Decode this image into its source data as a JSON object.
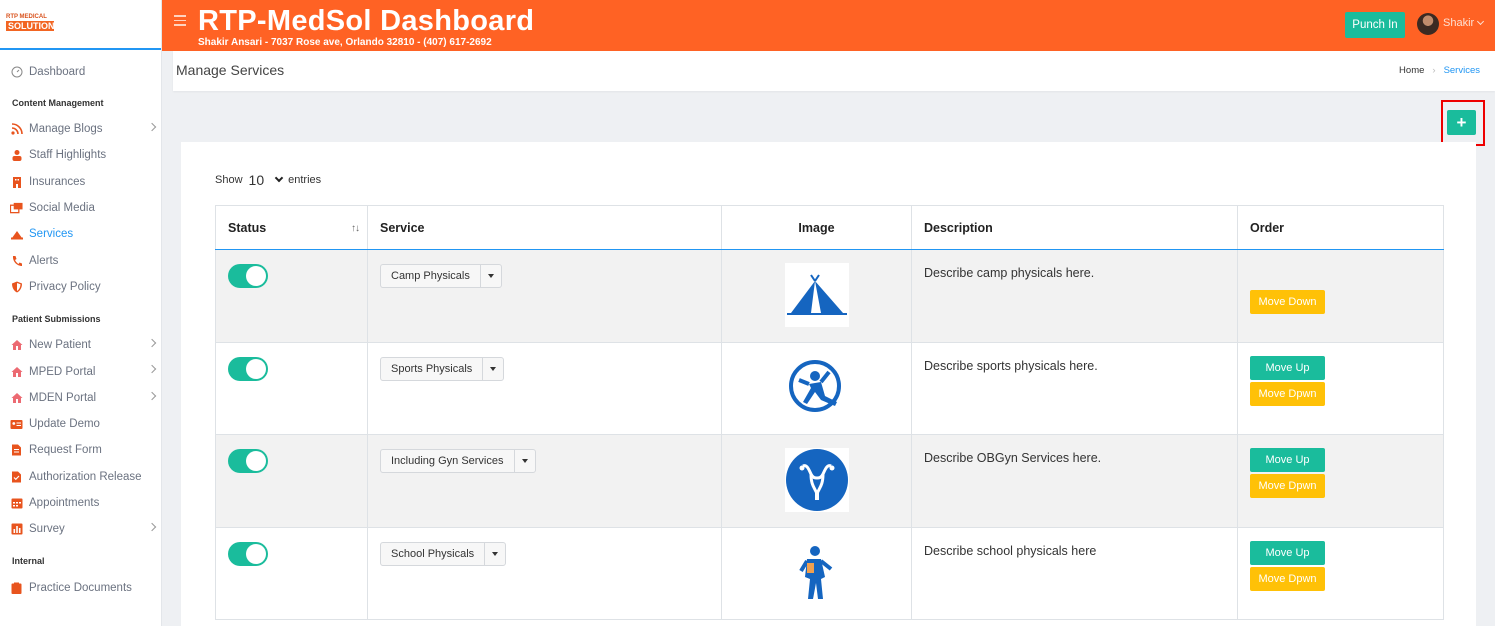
{
  "brand": {
    "logo_top": "RTP MEDICAL",
    "logo_bottom": "SOLUTION"
  },
  "header": {
    "title": "RTP-MedSol Dashboard",
    "subtitle": "Shakir Ansari - 7037 Rose ave, Orlando 32810 - (407) 617-2692",
    "punch_label": "Punch In",
    "user_name": "Shakir"
  },
  "sidebar": {
    "dashboard": "Dashboard",
    "sections": [
      {
        "title": "Content Management",
        "items": [
          {
            "label": "Manage Blogs",
            "icon": "rss-icon",
            "has_submenu": true
          },
          {
            "label": "Staff Highlights",
            "icon": "user-icon",
            "has_submenu": false
          },
          {
            "label": "Insurances",
            "icon": "building-icon",
            "has_submenu": false
          },
          {
            "label": "Social Media",
            "icon": "share-icon",
            "has_submenu": false
          },
          {
            "label": "Services",
            "icon": "hat-icon",
            "has_submenu": false,
            "active": true
          },
          {
            "label": "Alerts",
            "icon": "phone-icon",
            "has_submenu": false
          },
          {
            "label": "Privacy Policy",
            "icon": "shield-icon",
            "has_submenu": false
          }
        ]
      },
      {
        "title": "Patient Submissions",
        "items": [
          {
            "label": "New Patient",
            "icon": "home-icon",
            "has_submenu": true
          },
          {
            "label": "MPED Portal",
            "icon": "home-icon",
            "has_submenu": true
          },
          {
            "label": "MDEN Portal",
            "icon": "home-icon",
            "has_submenu": true
          },
          {
            "label": "Update Demo",
            "icon": "id-card-icon",
            "has_submenu": false
          },
          {
            "label": "Request Form",
            "icon": "file-icon",
            "has_submenu": false
          },
          {
            "label": "Authorization Release",
            "icon": "check-file-icon",
            "has_submenu": false
          },
          {
            "label": "Appointments",
            "icon": "calendar-icon",
            "has_submenu": false
          },
          {
            "label": "Survey",
            "icon": "bar-chart-icon",
            "has_submenu": true
          }
        ]
      },
      {
        "title": "Internal",
        "items": [
          {
            "label": "Practice Documents",
            "icon": "clipboard-icon",
            "has_submenu": false
          }
        ]
      }
    ]
  },
  "page": {
    "title": "Manage Services",
    "breadcrumb": [
      "Home",
      "Services"
    ],
    "add_label": "+"
  },
  "table": {
    "show_label": "Show",
    "entries_value": "10",
    "entries_label": "entries",
    "headers": [
      "Status",
      "Service",
      "Image",
      "Description",
      "Order"
    ],
    "rows": [
      {
        "service": "Camp Physicals",
        "image": "tent-icon",
        "description": "Describe camp physicals here.",
        "up": null,
        "down": "Move Down"
      },
      {
        "service": "Sports Physicals",
        "image": "sports-icon",
        "description": "Describe sports physicals here.",
        "up": "Move Up",
        "down": "Move Dpwn"
      },
      {
        "service": "Including Gyn Services",
        "image": "uterus-icon",
        "description": "Describe OBGyn Services here.",
        "up": "Move Up",
        "down": "Move Dpwn"
      },
      {
        "service": "School Physicals",
        "image": "student-icon",
        "description": "Describe school physicals here",
        "up": "Move Up",
        "down": "Move Dpwn"
      }
    ]
  },
  "colors": {
    "header": "#ff6224",
    "accent": "#1abc9c",
    "warning": "#ffc107",
    "link": "#2196f3"
  }
}
